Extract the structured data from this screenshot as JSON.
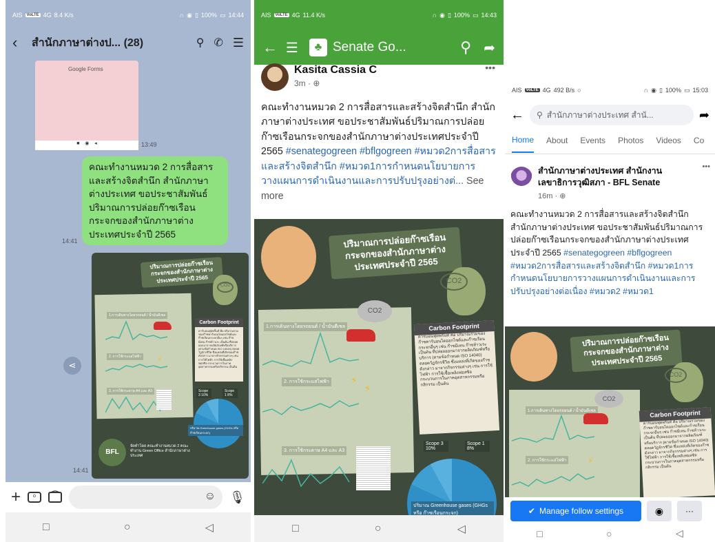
{
  "line": {
    "status": {
      "carrier": "AIS",
      "volte": "VoLTE",
      "signal": "4G",
      "speed": "8.4 K/s",
      "battery": "100%",
      "time": "14:44"
    },
    "header": {
      "title": "สำนักภาษาต่างป... (28)"
    },
    "forms_preview": {
      "brand": "Google Forms",
      "time": "13:49"
    },
    "message": {
      "text": "คณะทำงานหมวด 2 การสื่อสารและสร้างจิตสำนึก สำนักภาษาต่างประเทศ ขอประชาสัมพันธ์ปริมาณการปล่อยก๊าซเรือนกระจกของสำนักภาษาต่างประเทศประจำปี 2565",
      "time": "14:41"
    },
    "image_msg": {
      "time": "14:41"
    },
    "colors": {
      "bg": "#a9b8d1",
      "header": "#a9b8d1",
      "bubble": "#8fe07f"
    }
  },
  "fb": {
    "status": {
      "carrier": "AIS",
      "volte": "VoLTE",
      "signal": "4G",
      "speed": "11.4 K/s",
      "battery": "100%",
      "time": "14:43"
    },
    "header": {
      "title": "Senate Go..."
    },
    "post": {
      "author": "Kasita Cassia C",
      "time": "3m · ",
      "text": "คณะทำงานหมวด 2 การสื่อสารและสร้างจิตสำนึก สำนักภาษาต่างประเทศ ขอประชาสัมพันธ์ปริมาณการปล่อยก๊าซเรือนกระจกของสำนักภาษาต่างประเทศประจำปี 2565 ",
      "tags": "#senategogreen #bflgogreen #หมวด2การสื่อสารและสร้างจิตสำนึก #หมวด1การกำหนดนโยบายการวางแผนการดำเนินงานและการปรับปรุงอย่างต่...",
      "see_more": "See more"
    },
    "colors": {
      "header": "#4aa23a"
    }
  },
  "page": {
    "status": {
      "carrier": "AIS",
      "volte": "VoLTE",
      "signal": "4G",
      "speed": "492 B/s",
      "battery": "100%",
      "time": "15:03"
    },
    "search": {
      "text": "สำนักภาษาต่างประเทศ สำนั..."
    },
    "tabs": [
      "Home",
      "About",
      "Events",
      "Photos",
      "Videos",
      "Co"
    ],
    "post": {
      "author": "สำนักภาษาต่างประเทศ สำนักงานเลขาธิการวุฒิสภา - BFL Senate",
      "time": "16m · ",
      "text": "คณะทำงานหมวด 2 การสื่อสารและสร้างจิตสำนึก สำนักภาษาต่างประเทศ ขอประชาสัมพันธ์ปริมาณการปล่อยก๊าซเรือนกระจกของสำนักภาษาต่างประเทศประจำปี 2565 ",
      "tags": "#senategogreen #bflgogreen #หมวด2การสื่อสารและสร้างจิตสำนึก #หมวด1การกำหนดนโยบายการวางแผนการดำเนินงานและการปรับปรุงอย่างต่อเนื่อง #หมวด2 #หมวด1"
    },
    "buttons": {
      "manage": "Manage follow settings",
      "more": "···"
    }
  },
  "infographic": {
    "title": "ปริมาณการปล่อยก๊าซเรือนกระจกของสำนักภาษาต่างประเทศประจำปี 2565",
    "co2": "CO2",
    "chart1": "1.การเดินทางโดยรถยนต์ / น้ำมันดีเซล",
    "chart2": "2. การใช้กระแสไฟฟ้า",
    "chart3": "3. การใช้กระดาษ A4 และ A3",
    "cf_title": "Carbon Footprint",
    "cf_text": "คาร์บอนฟุตพริ้นท์ คือ ปริมาณรวมของก๊าซคาร์บอนไดออกไซด์และก๊าซเรือนกระจกอื่นๆ เช่น ก๊าซมีเทน ก๊าซห้าวเระ เป็นต้น ที่ปล่อยออกมาจากผลิตภัณฑ์หรือบริการ (ตามข้อกำหนด ISO 14040) ตลอดวัฏจักรชีวิต ซึ่งแหล่งที่เกิดของก๊าซดังกล่าว มาจากกิจกรรมต่างๆ เช่น การใช้ไฟฟ้า การใช้เชื้อเพลิงฟอสซิล กระบวนการในภาคอุตสาหกรรมหรือกสิกรรม เป็นต้น",
    "scope3": "Scope 3 10%",
    "scope1": "Scope 1 8%",
    "pie_note": "ปริมาณ Greenhouse gases (GHGs หรือ ก๊าซเรือนกระจก)",
    "team": "จัดทำโดย คณะทำงานหมวด 2 คณะทำงาน Green Office สำนักภาษาต่างประเทศ",
    "bfl": "BFL"
  }
}
